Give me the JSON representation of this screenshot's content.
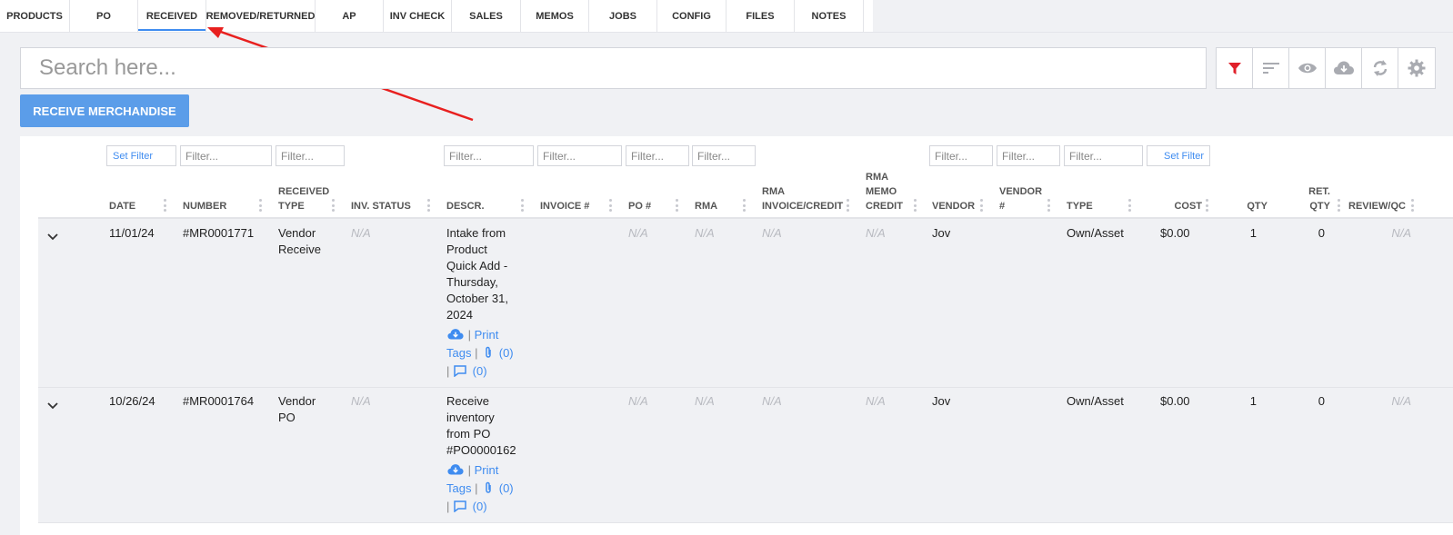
{
  "tabs": [
    {
      "label": "PRODUCTS"
    },
    {
      "label": "PO"
    },
    {
      "label": "RECEIVED",
      "active": true
    },
    {
      "label": "REMOVED/RETURNED"
    },
    {
      "label": "AP"
    },
    {
      "label": "INV CHECK"
    },
    {
      "label": "SALES"
    },
    {
      "label": "MEMOS"
    },
    {
      "label": "JOBS"
    },
    {
      "label": "CONFIG"
    },
    {
      "label": "FILES"
    },
    {
      "label": "NOTES"
    }
  ],
  "search": {
    "placeholder": "Search here..."
  },
  "toolbar": {
    "icons": [
      "filter-icon",
      "sort-icon",
      "eye-icon",
      "cloud-download-icon",
      "refresh-icon",
      "gear-icon"
    ],
    "accent": "#e0202a"
  },
  "receive_button": "RECEIVE MERCHANDISE",
  "filters": {
    "set_filter": "Set Filter",
    "placeholder": "Filter..."
  },
  "columns": {
    "date": "DATE",
    "number": "NUMBER",
    "received_type": [
      "RECEIVED",
      "TYPE"
    ],
    "inv_status": "INV. STATUS",
    "descr": "DESCR.",
    "invoice": "INVOICE #",
    "po": "PO #",
    "rma": "RMA",
    "rma_invoice": [
      "RMA",
      "INVOICE/CREDIT"
    ],
    "rma_memo": [
      "RMA",
      "MEMO",
      "CREDIT"
    ],
    "vendor": "VENDOR",
    "vendor_num": [
      "VENDOR",
      "#"
    ],
    "type": "TYPE",
    "cost": "COST",
    "qty": "QTY",
    "ret_qty": [
      "RET.",
      "QTY"
    ],
    "review": "REVIEW/QC"
  },
  "rows": [
    {
      "date": "11/01/24",
      "number": "#MR0001771",
      "received_type": [
        "Vendor",
        "Receive"
      ],
      "inv_status": "N/A",
      "descr": [
        "Intake from",
        "Product",
        "Quick Add -",
        "Thursday,",
        "October 31,",
        "2024"
      ],
      "po": "N/A",
      "rma": "N/A",
      "rma_invoice": "N/A",
      "rma_memo": "N/A",
      "vendor": "Jov",
      "type": "Own/Asset",
      "cost": "$0.00",
      "qty": "1",
      "ret_qty": "0",
      "review": "N/A",
      "links": {
        "print": "Print",
        "tags": "Tags",
        "attachments": "(0)",
        "comments": "(0)",
        "sep": "|"
      }
    },
    {
      "date": "10/26/24",
      "number": "#MR0001764",
      "received_type": [
        "Vendor",
        "PO"
      ],
      "inv_status": "N/A",
      "descr": [
        "Receive",
        "inventory",
        "from PO",
        "#PO0000162"
      ],
      "po": "N/A",
      "rma": "N/A",
      "rma_invoice": "N/A",
      "rma_memo": "N/A",
      "vendor": "Jov",
      "type": "Own/Asset",
      "cost": "$0.00",
      "qty": "1",
      "ret_qty": "0",
      "review": "N/A",
      "links": {
        "print": "Print",
        "tags": "Tags",
        "attachments": "(0)",
        "comments": "(0)",
        "sep": "|"
      }
    }
  ]
}
